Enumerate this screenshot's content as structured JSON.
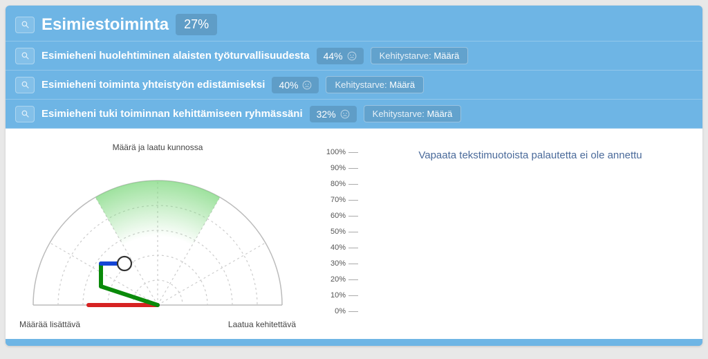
{
  "header": {
    "title": "Esimiestoiminta",
    "percent": "27%"
  },
  "rows": [
    {
      "label": "Esimieheni huolehtiminen alaisten työturvallisuudesta",
      "percent": "44%",
      "dev_label": "Kehitystarve:",
      "dev_value": "Määrä"
    },
    {
      "label": "Esimieheni toiminta yhteistyön edistämiseksi",
      "percent": "40%",
      "dev_label": "Kehitystarve:",
      "dev_value": "Määrä"
    },
    {
      "label": "Esimieheni tuki toiminnan kehittämiseen ryhmässäni",
      "percent": "32%",
      "dev_label": "Kehitystarve:",
      "dev_value": "Määrä"
    }
  ],
  "gauge": {
    "label_top": "Määrä ja laatu kunnossa",
    "label_left": "Määrää lisättävä",
    "label_right": "Laatua kehitettävä"
  },
  "scale": [
    "100%",
    "90%",
    "80%",
    "70%",
    "60%",
    "50%",
    "40%",
    "30%",
    "20%",
    "10%",
    "0%"
  ],
  "feedback": {
    "empty_text": "Vapaata tekstimuotoista palautetta ei ole annettu"
  },
  "chart_data": {
    "type": "gauge",
    "title": "Esimiestoiminta",
    "overall_percent": 27,
    "axis_left": "Määrää lisättävä",
    "axis_top": "Määrä ja laatu kunnossa",
    "axis_right": "Laatua kehitettävä",
    "scale_ticks": [
      0,
      10,
      20,
      30,
      40,
      50,
      60,
      70,
      80,
      90,
      100
    ],
    "series": [
      {
        "name": "Esimieheni huolehtiminen alaisten työturvallisuudesta",
        "value": 44,
        "development_need": "Määrä"
      },
      {
        "name": "Esimieheni toiminta yhteistyön edistämiseksi",
        "value": 40,
        "development_need": "Määrä"
      },
      {
        "name": "Esimieheni tuki toiminnan kehittämiseen ryhmässäni",
        "value": 32,
        "development_need": "Määrä"
      }
    ],
    "needles": [
      {
        "color": "#d62222",
        "angle_deg_from_left": 0,
        "length_pct": 55
      },
      {
        "color": "#0a8a0a",
        "angle_deg_from_left": 18,
        "length_pct": 48
      },
      {
        "color": "#1646d6",
        "angle_deg_from_left": 38,
        "length_pct": 43
      }
    ]
  }
}
